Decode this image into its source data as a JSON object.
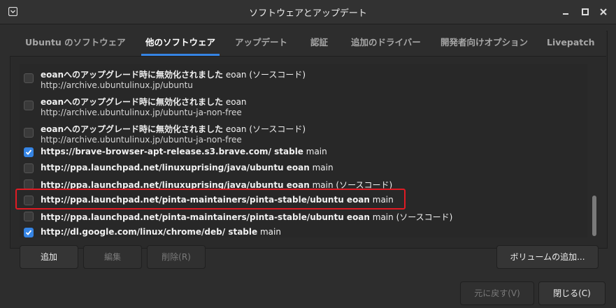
{
  "window": {
    "title": "ソフトウェアとアップデート"
  },
  "tabs": [
    {
      "label": "Ubuntu のソフトウェア",
      "active": false
    },
    {
      "label": "他のソフトウェア",
      "active": true
    },
    {
      "label": "アップデート",
      "active": false
    },
    {
      "label": "認証",
      "active": false
    },
    {
      "label": "追加のドライバー",
      "active": false
    },
    {
      "label": "開発者向けオプション",
      "active": false
    },
    {
      "label": "Livepatch",
      "active": false
    }
  ],
  "sources": [
    {
      "checked": false,
      "bold": "eoanへのアップグレード時に無効化されました",
      "rest": " eoan (ソースコード)",
      "url": "http://archive.ubuntulinux.jp/ubuntu"
    },
    {
      "checked": false,
      "bold": "eoanへのアップグレード時に無効化されました",
      "rest": " eoan",
      "url": "http://archive.ubuntulinux.jp/ubuntu-ja-non-free"
    },
    {
      "checked": false,
      "bold": "eoanへのアップグレード時に無効化されました",
      "rest": " eoan (ソースコード)",
      "url": "http://archive.ubuntulinux.jp/ubuntu-ja-non-free"
    },
    {
      "checked": true,
      "bold": "https://brave-browser-apt-release.s3.brave.com/ stable",
      "rest": " main",
      "url": ""
    },
    {
      "checked": false,
      "bold": "http://ppa.launchpad.net/linuxuprising/java/ubuntu eoan",
      "rest": " main",
      "url": ""
    },
    {
      "checked": false,
      "bold": "http://ppa.launchpad.net/linuxuprising/java/ubuntu eoan",
      "rest": " main (ソースコード)",
      "url": ""
    },
    {
      "checked": false,
      "bold": "http://ppa.launchpad.net/pinta-maintainers/pinta-stable/ubuntu eoan",
      "rest": " main",
      "url": ""
    },
    {
      "checked": false,
      "bold": "http://ppa.launchpad.net/pinta-maintainers/pinta-stable/ubuntu eoan",
      "rest": " main (ソースコード)",
      "url": ""
    },
    {
      "checked": true,
      "bold": "http://dl.google.com/linux/chrome/deb/ stable",
      "rest": " main",
      "url": ""
    }
  ],
  "buttons": {
    "add": "追加",
    "edit": "編集",
    "remove": "削除(R)",
    "add_volume": "ボリュームの追加...",
    "revert": "元に戻す(V)",
    "close": "閉じる(C)"
  },
  "colors": {
    "accent": "#3584e4",
    "highlight": "#e01b24"
  }
}
